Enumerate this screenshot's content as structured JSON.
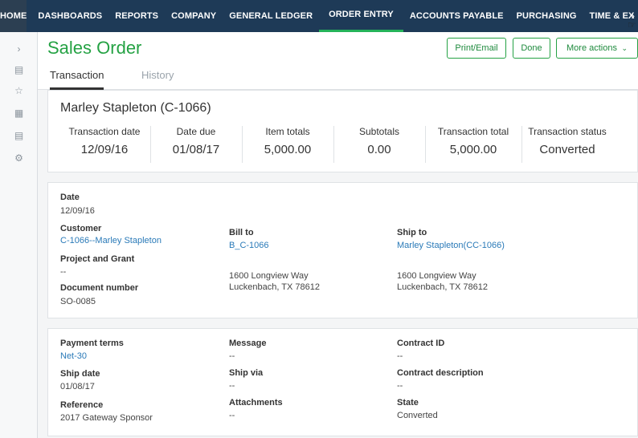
{
  "nav": {
    "items": [
      "HOME",
      "DASHBOARDS",
      "REPORTS",
      "COMPANY",
      "GENERAL LEDGER",
      "ORDER ENTRY",
      "ACCOUNTS PAYABLE",
      "PURCHASING",
      "TIME & EX"
    ],
    "active": "ORDER ENTRY",
    "next_icon": "chevron-right-icon"
  },
  "rail": {
    "icons": [
      "chevron-right-icon",
      "list-icon",
      "star-icon",
      "grid-icon",
      "document-icon",
      "gear-icon"
    ]
  },
  "header": {
    "title": "Sales Order",
    "print_label": "Print/Email",
    "done_label": "Done",
    "more_label": "More actions"
  },
  "tabs": [
    "Transaction",
    "History"
  ],
  "summary": {
    "name": "Marley Stapleton (C-1066)",
    "stats": [
      {
        "label": "Transaction date",
        "value": "12/09/16"
      },
      {
        "label": "Date due",
        "value": "01/08/17"
      },
      {
        "label": "Item totals",
        "value": "5,000.00"
      },
      {
        "label": "Subtotals",
        "value": "0.00"
      },
      {
        "label": "Transaction total",
        "value": "5,000.00"
      },
      {
        "label": "Transaction status",
        "value": "Converted"
      }
    ]
  },
  "details": {
    "date_label": "Date",
    "date_value": "12/09/16",
    "customer_label": "Customer",
    "customer_value": "C-1066--Marley Stapleton",
    "project_label": "Project and Grant",
    "project_value": "--",
    "docnum_label": "Document number",
    "docnum_value": "SO-0085",
    "billto_label": "Bill to",
    "billto_value": "B_C-1066",
    "bill_addr1": "1600 Longview Way",
    "bill_addr2": "Luckenbach, TX 78612",
    "shipto_label": "Ship to",
    "shipto_value": "Marley Stapleton(CC-1066)",
    "ship_addr1": "1600 Longview Way",
    "ship_addr2": "Luckenbach, TX 78612"
  },
  "details2": {
    "payterms_label": "Payment terms",
    "payterms_value": "Net-30",
    "shipdate_label": "Ship date",
    "shipdate_value": "01/08/17",
    "reference_label": "Reference",
    "reference_value": "2017 Gateway Sponsor",
    "message_label": "Message",
    "message_value": "--",
    "shipvia_label": "Ship via",
    "shipvia_value": "--",
    "attachments_label": "Attachments",
    "attachments_value": "--",
    "contract_label": "Contract ID",
    "contract_value": "--",
    "contractdesc_label": "Contract description",
    "contractdesc_value": "--",
    "state_label": "State",
    "state_value": "Converted"
  },
  "colors": {
    "nav_bg": "#1e3a57",
    "accent_green": "#25a244",
    "link_blue": "#2a7ab8"
  }
}
